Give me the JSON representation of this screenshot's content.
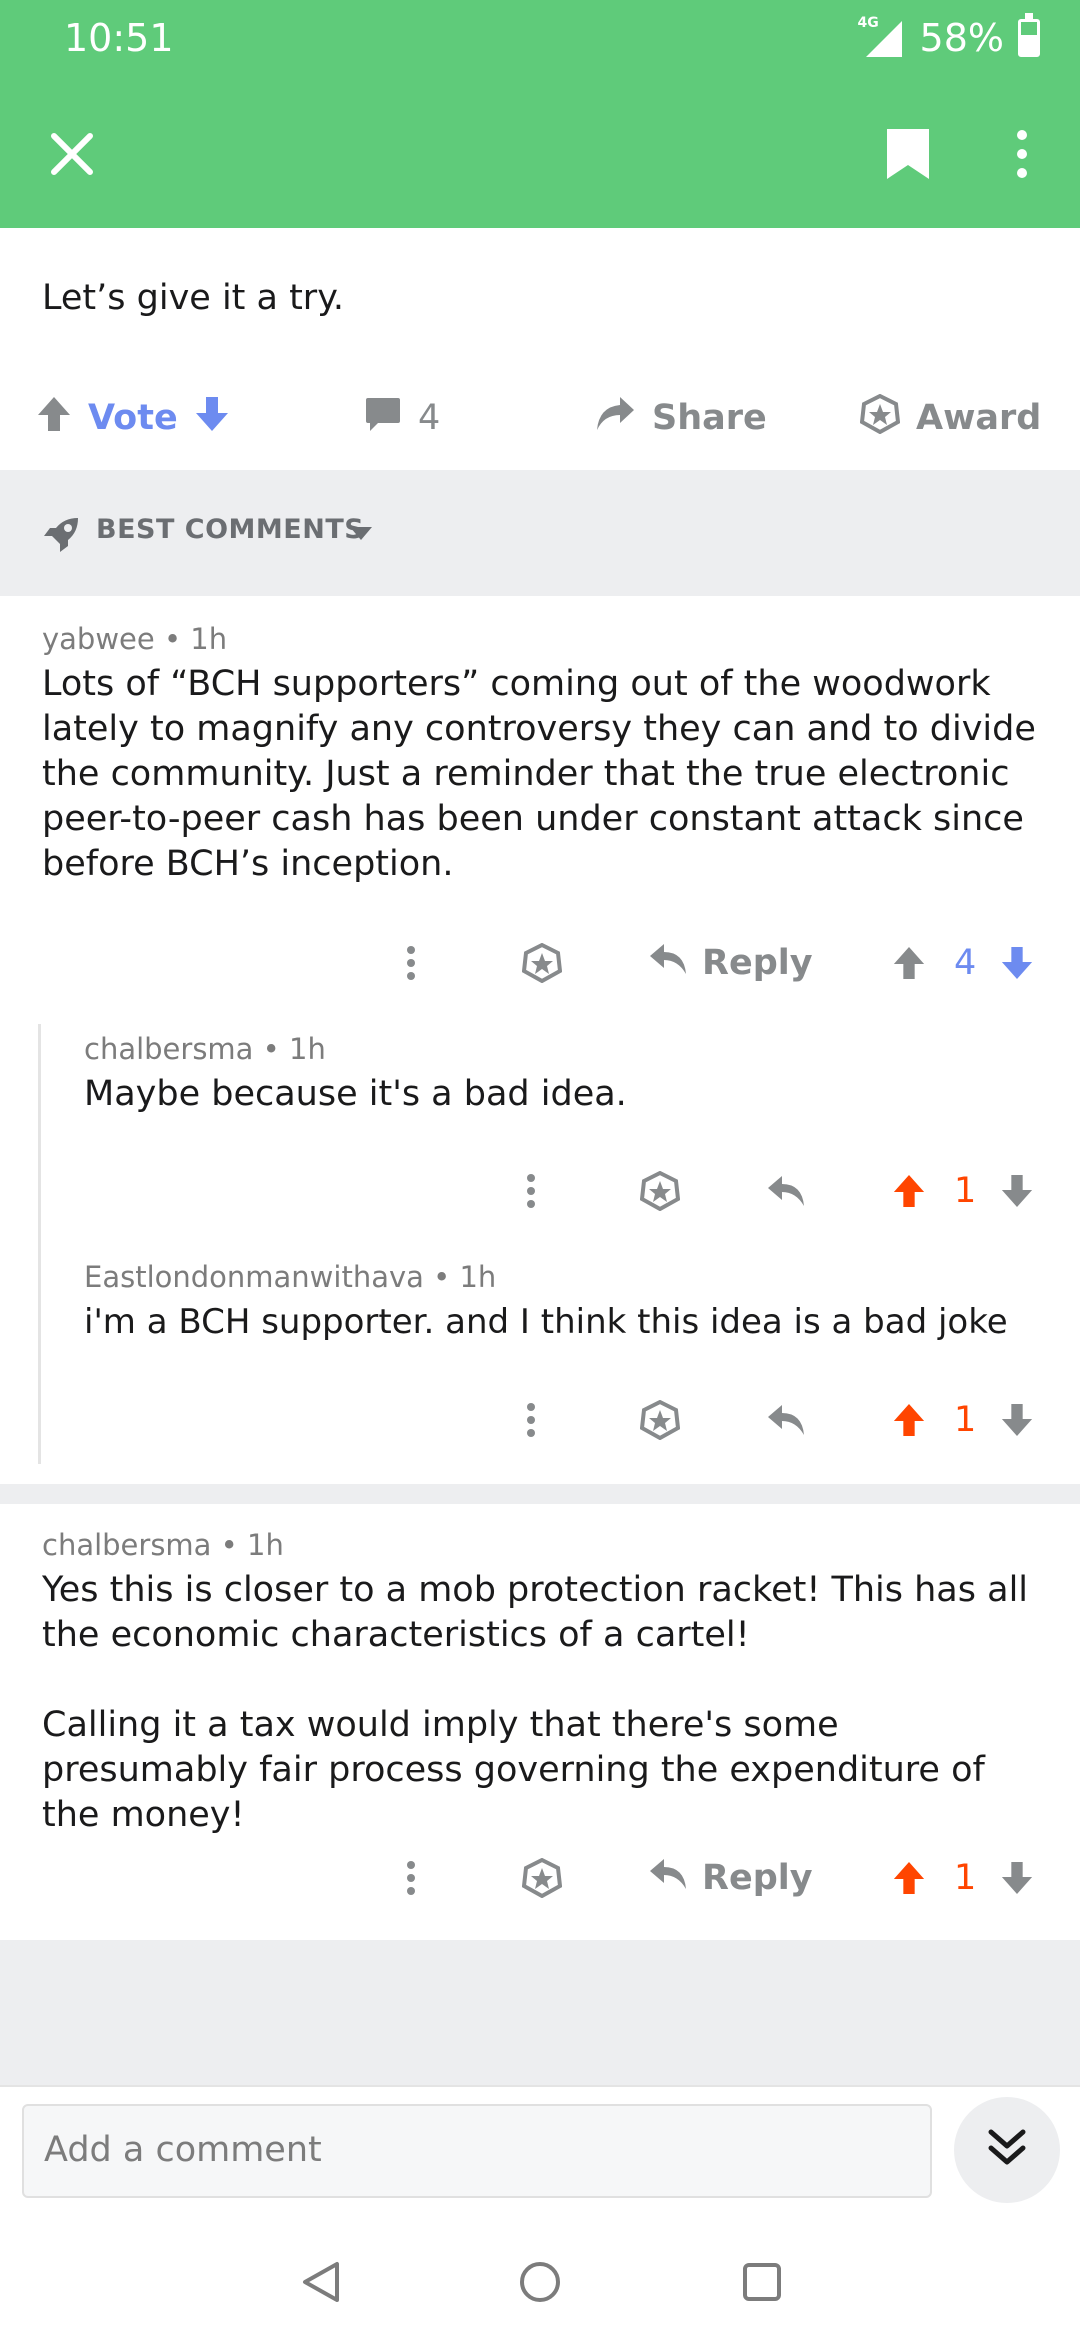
{
  "status": {
    "time": "10:51",
    "network": "4G",
    "battery": "58%",
    "battery_level": 0.58
  },
  "post": {
    "body": "Let’s give it a try.",
    "vote_label": "Vote",
    "comment_count": "4",
    "share_label": "Share",
    "award_label": "Award"
  },
  "sort": {
    "label": "BEST COMMENTS"
  },
  "comments": [
    {
      "author": "yabwee",
      "age": "1h",
      "body": "Lots of “BCH supporters” coming out of the woodwork lately to magnify any controversy they can and to divide the community. Just a reminder that the true electronic peer-to-peer cash has been under constant attack since before BCH’s inception.",
      "reply_label": "Reply",
      "score": "4"
    },
    {
      "author": "chalbersma",
      "age": "1h",
      "body": "Maybe because it's a bad idea.",
      "score": "1"
    },
    {
      "author": "Eastlondonmanwithava",
      "age": "1h",
      "body": "i'm a BCH supporter. and I think this idea is a bad joke",
      "score": "1"
    },
    {
      "author": "chalbersma",
      "age": "1h",
      "body_p1": "Yes this is closer to a mob protection racket! This has all the economic characteristics of a cartel!",
      "body_p2": "Calling it a tax would imply that there's some presumably fair process governing the expenditure of the money!",
      "reply_label": "Reply",
      "score": "1"
    }
  ],
  "composer": {
    "placeholder": "Add a comment"
  },
  "colors": {
    "brand_green": "#5fcb7a",
    "upvote_orange": "#ff4500",
    "vote_blue": "#6d8bf0",
    "icon_gray": "#878a8c"
  },
  "icons": [
    "close-icon",
    "bookmark-icon",
    "more-vert-icon",
    "upvote-icon",
    "downvote-icon",
    "comment-icon",
    "share-icon",
    "award-icon",
    "rocket-icon",
    "dropdown-icon",
    "reply-icon",
    "double-chevron-down-icon",
    "back-icon",
    "home-icon",
    "recents-icon"
  ]
}
